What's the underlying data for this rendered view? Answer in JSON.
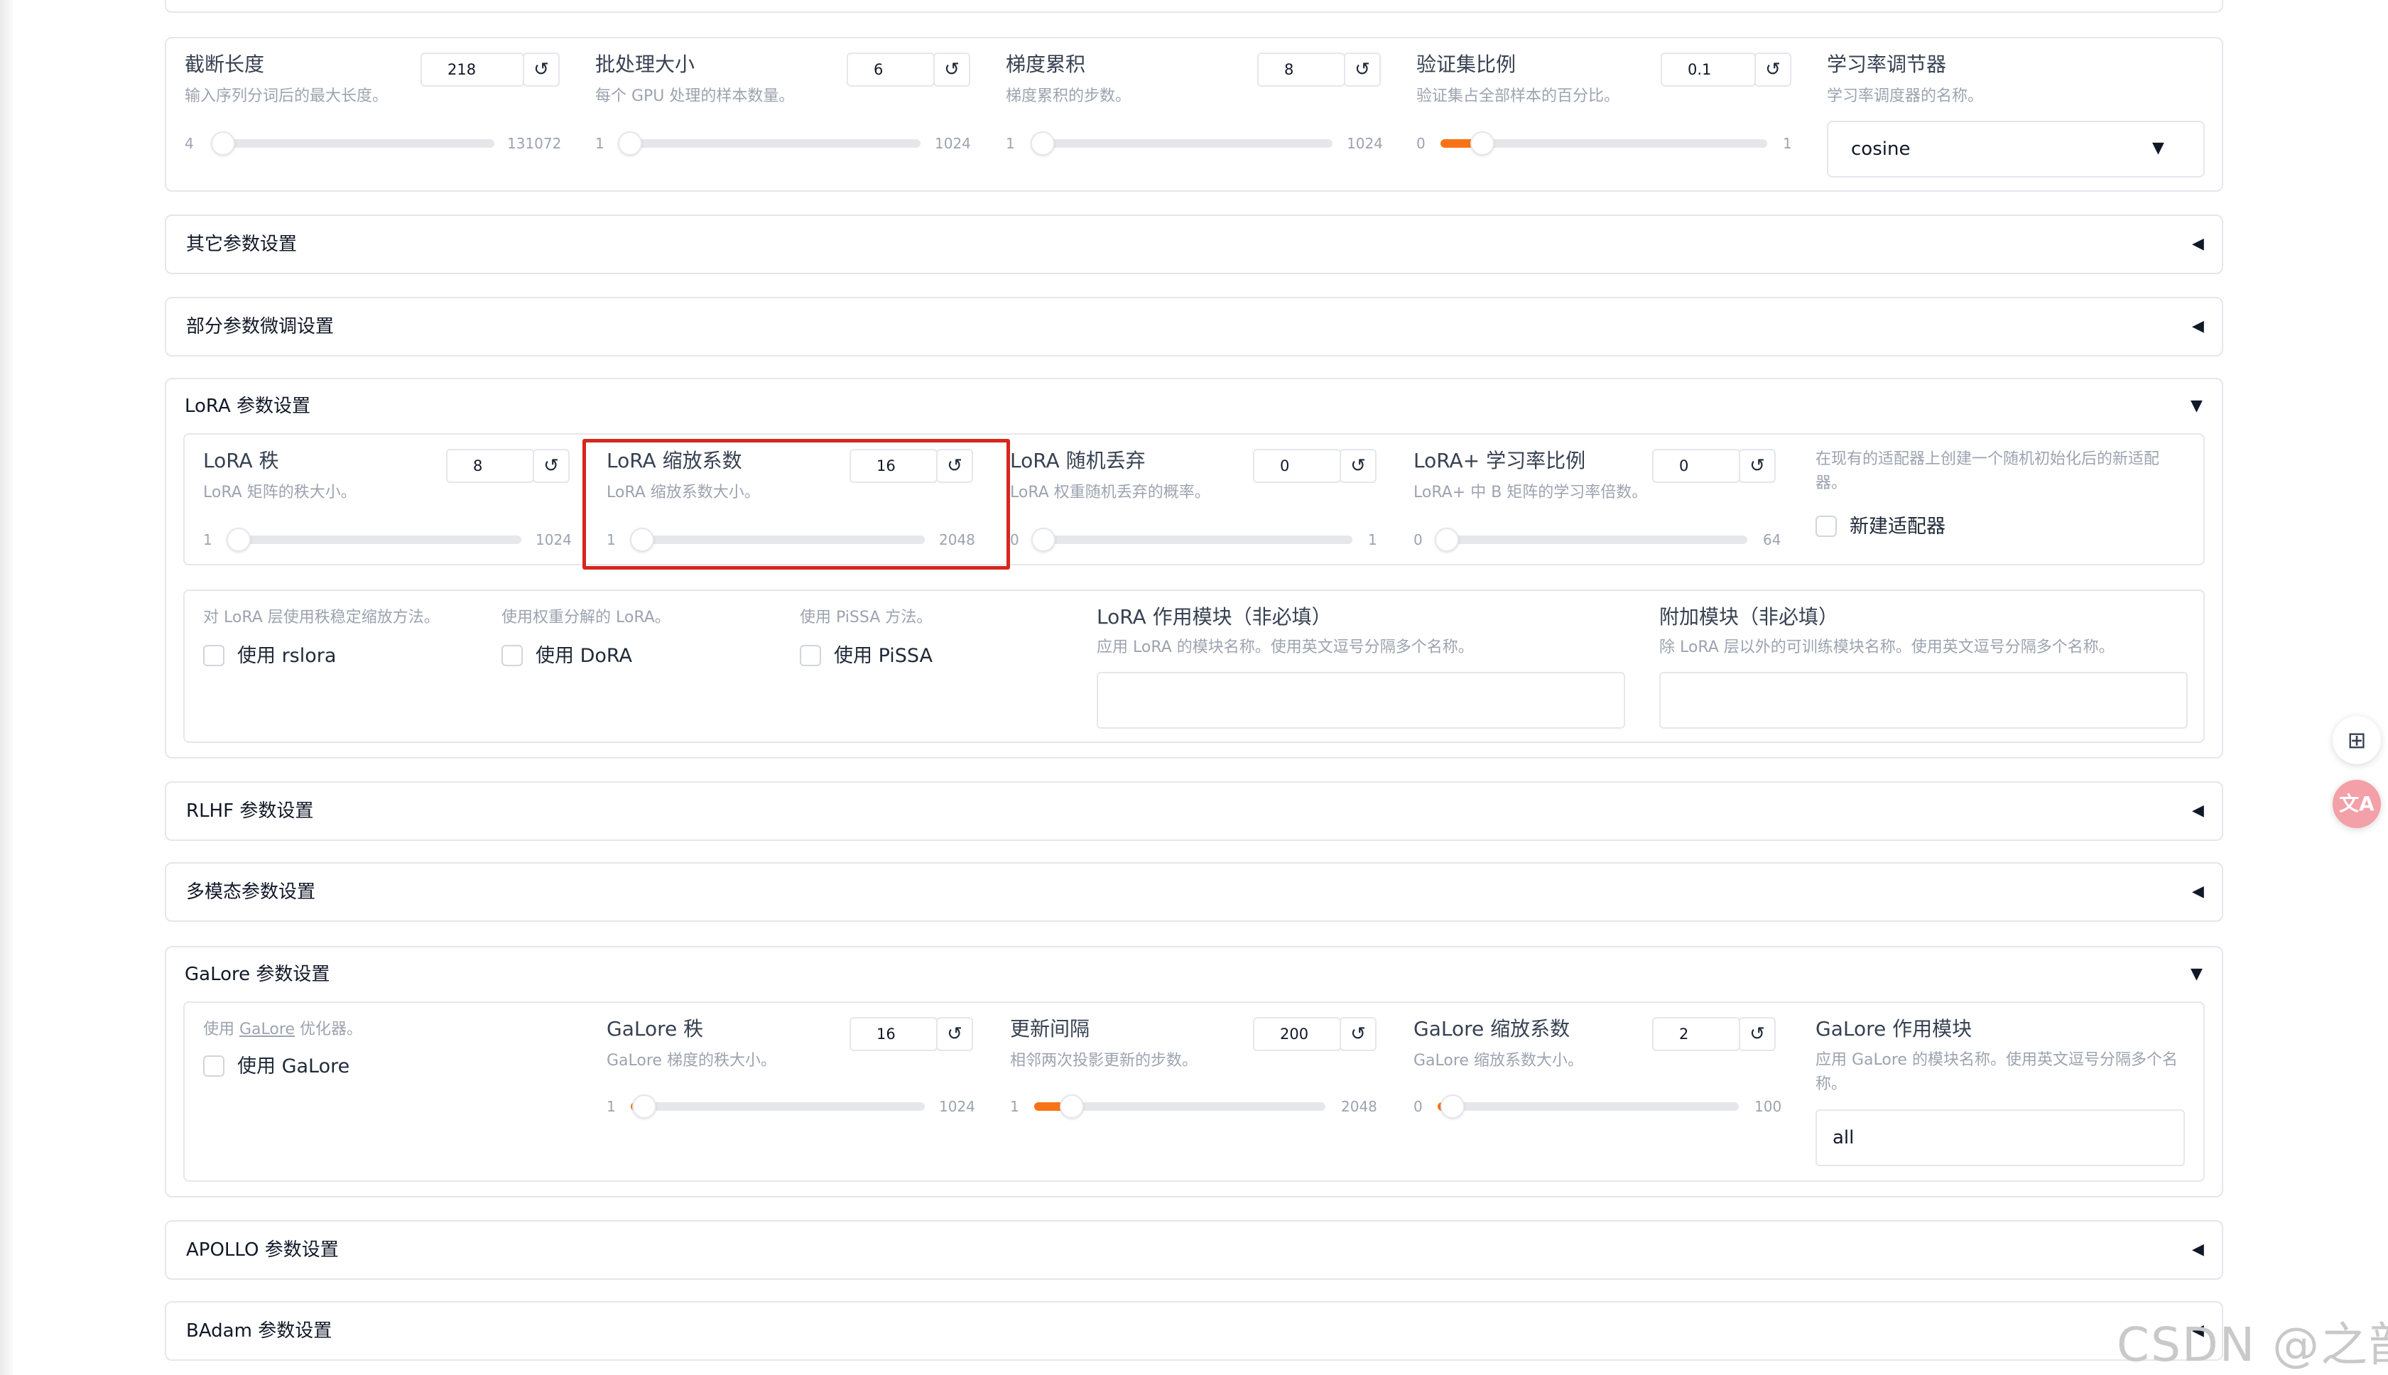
{
  "top_params": {
    "cutoff": {
      "label": "截断长度",
      "info": "输入序列分词后的最大长度。",
      "value": "218",
      "min": "4",
      "max": "131072",
      "fraction": 0.0016
    },
    "batch": {
      "label": "批处理大小",
      "info": "每个 GPU 处理的样本数量。",
      "value": "6",
      "min": "1",
      "max": "1024",
      "fraction": 0.005
    },
    "grad_accum": {
      "label": "梯度累积",
      "info": "梯度累积的步数。",
      "value": "8",
      "min": "1",
      "max": "1024",
      "fraction": 0.007
    },
    "val_size": {
      "label": "验证集比例",
      "info": "验证集占全部样本的百分比。",
      "value": "0.1",
      "min": "0",
      "max": "1",
      "fraction": 0.1
    },
    "lr_scheduler": {
      "label": "学习率调节器",
      "info": "学习率调度器的名称。",
      "value": "cosine"
    }
  },
  "accordions": {
    "other": {
      "title": "其它参数设置",
      "arrow": "◀"
    },
    "freeze": {
      "title": "部分参数微调设置",
      "arrow": "◀"
    },
    "lora": {
      "title": "LoRA 参数设置",
      "arrow": "▼"
    },
    "rlhf": {
      "title": "RLHF 参数设置",
      "arrow": "◀"
    },
    "multimodal": {
      "title": "多模态参数设置",
      "arrow": "◀"
    },
    "galore": {
      "title": "GaLore 参数设置",
      "arrow": "▼"
    },
    "apollo": {
      "title": "APOLLO 参数设置",
      "arrow": "◀"
    },
    "badam": {
      "title": "BAdam 参数设置",
      "arrow": "◀"
    }
  },
  "lora": {
    "rank": {
      "label": "LoRA 秩",
      "info": "LoRA 矩阵的秩大小。",
      "value": "8",
      "min": "1",
      "max": "1024",
      "fraction": 0.007
    },
    "alpha": {
      "label": "LoRA 缩放系数",
      "info": "LoRA 缩放系数大小。",
      "value": "16",
      "min": "1",
      "max": "2048",
      "fraction": 0.007
    },
    "dropout": {
      "label": "LoRA 随机丢弃",
      "info": "LoRA 权重随机丢弃的概率。",
      "value": "0",
      "min": "0",
      "max": "1",
      "fraction": 0.0
    },
    "loraplus": {
      "label": "LoRA+ 学习率比例",
      "info": "LoRA+ 中 B 矩阵的学习率倍数。",
      "value": "0",
      "min": "0",
      "max": "64",
      "fraction": 0.0
    },
    "new_adapter": {
      "info": "在现有的适配器上创建一个随机初始化后的新适配器。",
      "label": "新建适配器",
      "checked": false
    },
    "rslora": {
      "info": "对 LoRA 层使用秩稳定缩放方法。",
      "label": "使用 rslora",
      "checked": false
    },
    "dora": {
      "info": "使用权重分解的 LoRA。",
      "label": "使用 DoRA",
      "checked": false
    },
    "pissa": {
      "info": "使用 PiSSA 方法。",
      "label": "使用 PiSSA",
      "checked": false
    },
    "target": {
      "label": "LoRA 作用模块（非必填）",
      "info": "应用 LoRA 的模块名称。使用英文逗号分隔多个名称。",
      "value": ""
    },
    "additional_target": {
      "label": "附加模块（非必填）",
      "info": "除 LoRA 层以外的可训练模块名称。使用英文逗号分隔多个名称。",
      "value": ""
    }
  },
  "galore": {
    "use": {
      "info_prefix": "使用 ",
      "info_link": "GaLore",
      "info_suffix": " 优化器。",
      "label": "使用 GaLore",
      "checked": false
    },
    "rank": {
      "label": "GaLore 秩",
      "info": "GaLore 梯度的秩大小。",
      "value": "16",
      "min": "1",
      "max": "1024",
      "fraction": 0.015
    },
    "interval": {
      "label": "更新间隔",
      "info": "相邻两次投影更新的步数。",
      "value": "200",
      "min": "1",
      "max": "2048",
      "fraction": 0.097
    },
    "scale": {
      "label": "GaLore 缩放系数",
      "info": "GaLore 缩放系数大小。",
      "value": "2",
      "min": "0",
      "max": "100",
      "fraction": 0.02
    },
    "target": {
      "label": "GaLore 作用模块",
      "info": "应用 GaLore 的模块名称。使用英文逗号分隔多个名称。",
      "value": "all"
    }
  },
  "ui": {
    "reset_glyph": "↺",
    "dropdown_glyph": "▼",
    "float_icon_1": "⊞",
    "float_icon_2": "文A",
    "watermark": "CSDN @之歆",
    "accent": "#f97316",
    "highlight": "#d7261c"
  }
}
